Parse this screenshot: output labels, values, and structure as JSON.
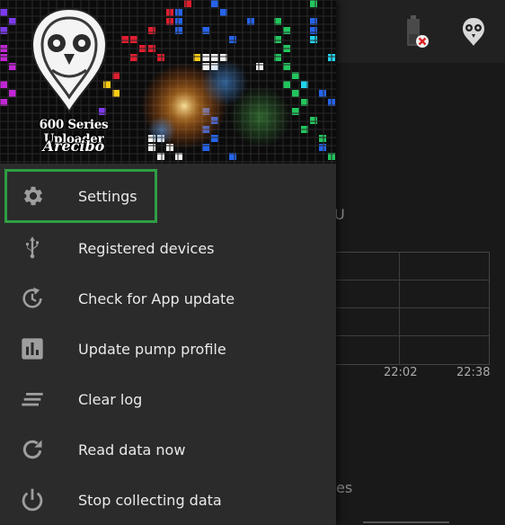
{
  "app": {
    "title": "600 Series Uploader",
    "subtitle": "Arecibo"
  },
  "appbar": {
    "icons": [
      "battery-disconnected-icon",
      "owl-icon"
    ]
  },
  "background": {
    "unit_fragment": "U",
    "x_ticks": [
      "22:02",
      "22:38"
    ],
    "text_fragment": "es"
  },
  "menu": {
    "items": [
      {
        "label": "Settings",
        "icon": "gear-icon"
      },
      {
        "label": "Registered devices",
        "icon": "usb-icon"
      },
      {
        "label": "Check for App update",
        "icon": "update-clock-icon"
      },
      {
        "label": "Update pump profile",
        "icon": "bar-chart-icon"
      },
      {
        "label": "Clear log",
        "icon": "clear-lines-icon"
      },
      {
        "label": "Read data now",
        "icon": "refresh-icon"
      },
      {
        "label": "Stop collecting data",
        "icon": "power-icon"
      }
    ]
  },
  "colors": {
    "drawer_bg": "#2b2b2b",
    "highlight": "#2e9e45",
    "icon": "#9e9e9e"
  }
}
